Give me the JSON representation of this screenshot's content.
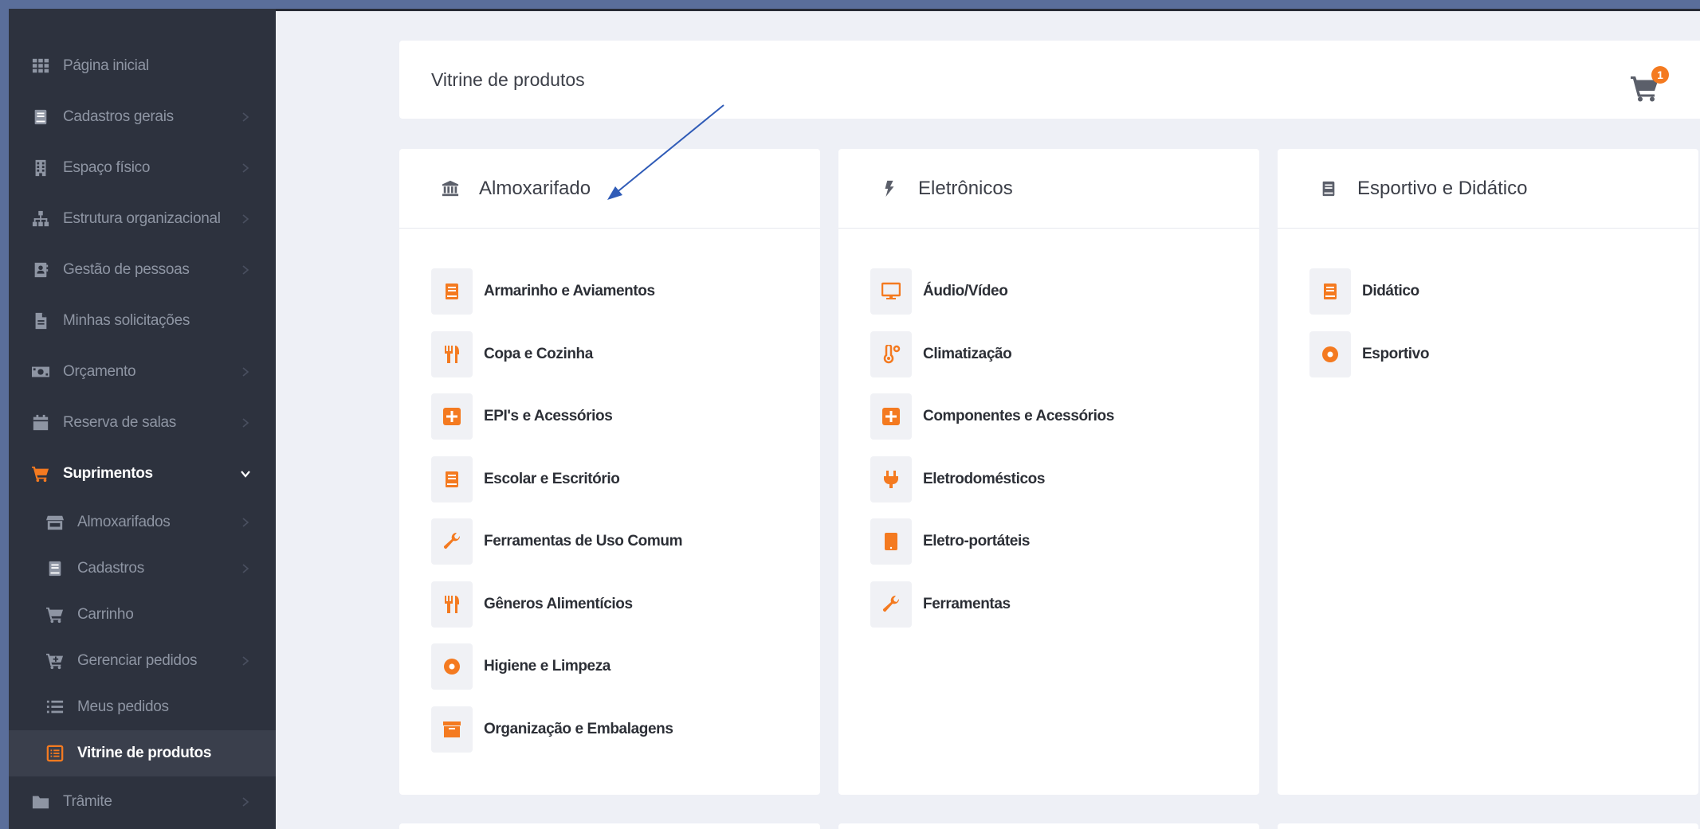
{
  "colors": {
    "accent": "#f47a20",
    "sidebar_bg": "#2d323e",
    "arrow": "#2f5bb7"
  },
  "sidebar": {
    "items": [
      {
        "label": "Página inicial",
        "icon": "grid-icon",
        "chevron": false
      },
      {
        "label": "Cadastros gerais",
        "icon": "book-icon",
        "chevron": true
      },
      {
        "label": "Espaço físico",
        "icon": "building-icon",
        "chevron": true
      },
      {
        "label": "Estrutura organizacional",
        "icon": "sitemap-icon",
        "chevron": true
      },
      {
        "label": "Gestão de pessoas",
        "icon": "address-book-icon",
        "chevron": true
      },
      {
        "label": "Minhas solicitações",
        "icon": "file-icon",
        "chevron": false
      },
      {
        "label": "Orçamento",
        "icon": "money-icon",
        "chevron": true
      },
      {
        "label": "Reserva de salas",
        "icon": "calendar-icon",
        "chevron": true
      },
      {
        "label": "Suprimentos",
        "icon": "cart-icon",
        "chevron": "down",
        "open": true
      },
      {
        "label": "Almoxarifados",
        "icon": "store-icon",
        "chevron": true,
        "sub": true
      },
      {
        "label": "Cadastros",
        "icon": "book-icon",
        "chevron": true,
        "sub": true
      },
      {
        "label": "Carrinho",
        "icon": "cart-icon",
        "chevron": false,
        "sub": true
      },
      {
        "label": "Gerenciar pedidos",
        "icon": "cart-plus-icon",
        "chevron": true,
        "sub": true
      },
      {
        "label": "Meus pedidos",
        "icon": "list-icon",
        "chevron": false,
        "sub": true
      },
      {
        "label": "Vitrine de produtos",
        "icon": "list-alt-icon",
        "chevron": false,
        "sub": true,
        "active": true
      },
      {
        "label": "Trâmite",
        "icon": "folder-icon",
        "chevron": true
      }
    ]
  },
  "header": {
    "title": "Vitrine de produtos",
    "cart_count": "1"
  },
  "cards": [
    {
      "title": "Almoxarifado",
      "icon": "bank-icon",
      "items": [
        {
          "label": "Armarinho e Aviamentos",
          "icon": "book-icon"
        },
        {
          "label": "Copa e Cozinha",
          "icon": "cutlery-icon"
        },
        {
          "label": "EPI's e Acessórios",
          "icon": "plus-square-icon"
        },
        {
          "label": "Escolar e Escritório",
          "icon": "book-icon"
        },
        {
          "label": "Ferramentas de Uso Comum",
          "icon": "wrench-icon"
        },
        {
          "label": "Gêneros Alimentícios",
          "icon": "cutlery-icon"
        },
        {
          "label": "Higiene e Limpeza",
          "icon": "circle-icon"
        },
        {
          "label": "Organização e Embalagens",
          "icon": "archive-icon"
        }
      ]
    },
    {
      "title": "Eletrônicos",
      "icon": "bolt-icon",
      "items": [
        {
          "label": "Áudio/Vídeo",
          "icon": "monitor-icon"
        },
        {
          "label": "Climatização",
          "icon": "thermometer-icon"
        },
        {
          "label": "Componentes e Acessórios",
          "icon": "plus-square-icon"
        },
        {
          "label": "Eletrodomésticos",
          "icon": "plug-icon"
        },
        {
          "label": "Eletro-portáteis",
          "icon": "tablet-icon"
        },
        {
          "label": "Ferramentas",
          "icon": "wrench-icon"
        }
      ]
    },
    {
      "title": "Esportivo e Didático",
      "icon": "book-icon",
      "items": [
        {
          "label": "Didático",
          "icon": "book-icon"
        },
        {
          "label": "Esportivo",
          "icon": "circle-icon"
        }
      ]
    }
  ]
}
